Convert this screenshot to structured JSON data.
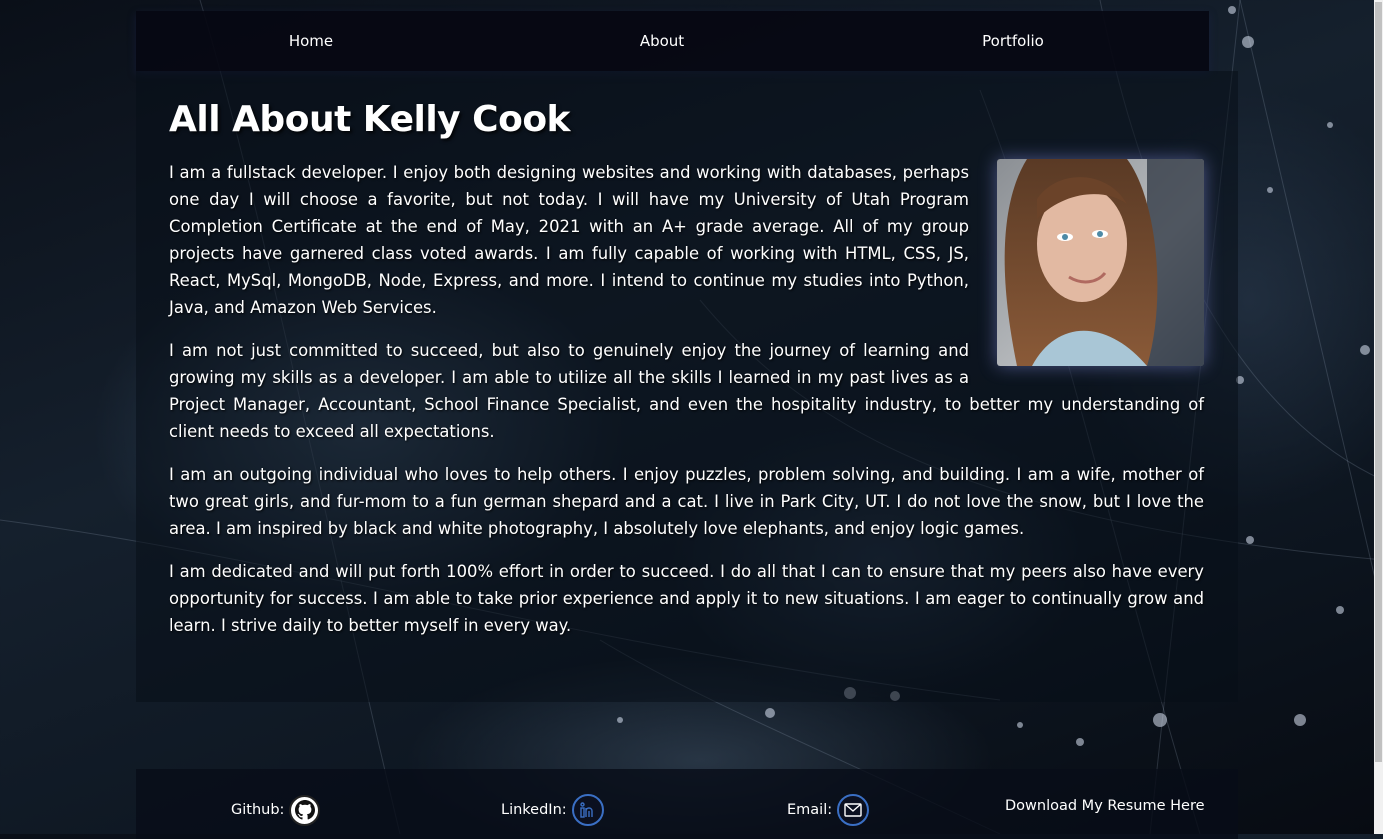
{
  "nav": {
    "home": "Home",
    "about": "About",
    "portfolio": "Portfolio"
  },
  "about": {
    "heading": "All About Kelly Cook",
    "paragraphs": [
      "I am a fullstack developer. I enjoy both designing websites and working with databases, perhaps one day I will choose a favorite, but not today. I will have my University of Utah Program Completion Certificate at the end of May, 2021 with an A+ grade average. All of my group projects have garnered class voted awards. I am fully capable of working with HTML, CSS, JS, React, MySql, MongoDB, Node, Express, and more. I intend to continue my studies into Python, Java, and Amazon Web Services.",
      "I am not just committed to succeed, but also to genuinely enjoy the journey of learning and growing my skills as a developer. I am able to utilize all the skills I learned in my past lives as a Project Manager, Accountant, School Finance Specialist, and even the hospitality industry, to better my understanding of client needs to exceed all expectations.",
      "I am an outgoing individual who loves to help others. I enjoy puzzles, problem solving, and building. I am a wife, mother of two great girls, and fur-mom to a fun german shepard and a cat. I live in Park City, UT. I do not love the snow, but I love the area. I am inspired by black and white photography, I absolutely love elephants, and enjoy logic games.",
      "I am dedicated and will put forth 100% effort in order to succeed. I do all that I can to ensure that my peers also have every opportunity for success. I am able to take prior experience and apply it to new situations. I am eager to continually grow and learn. I strive daily to better myself in every way."
    ]
  },
  "footer": {
    "github_label": "Github:",
    "linkedin_label": "LinkedIn:",
    "email_label": "Email:",
    "resume_label": "Download My Resume Here"
  },
  "icons": {
    "github": "github-icon",
    "linkedin": "linkedin-icon",
    "email": "envelope-icon"
  },
  "colors": {
    "nav_bg": "#060812",
    "accent": "#3a6fc4"
  }
}
